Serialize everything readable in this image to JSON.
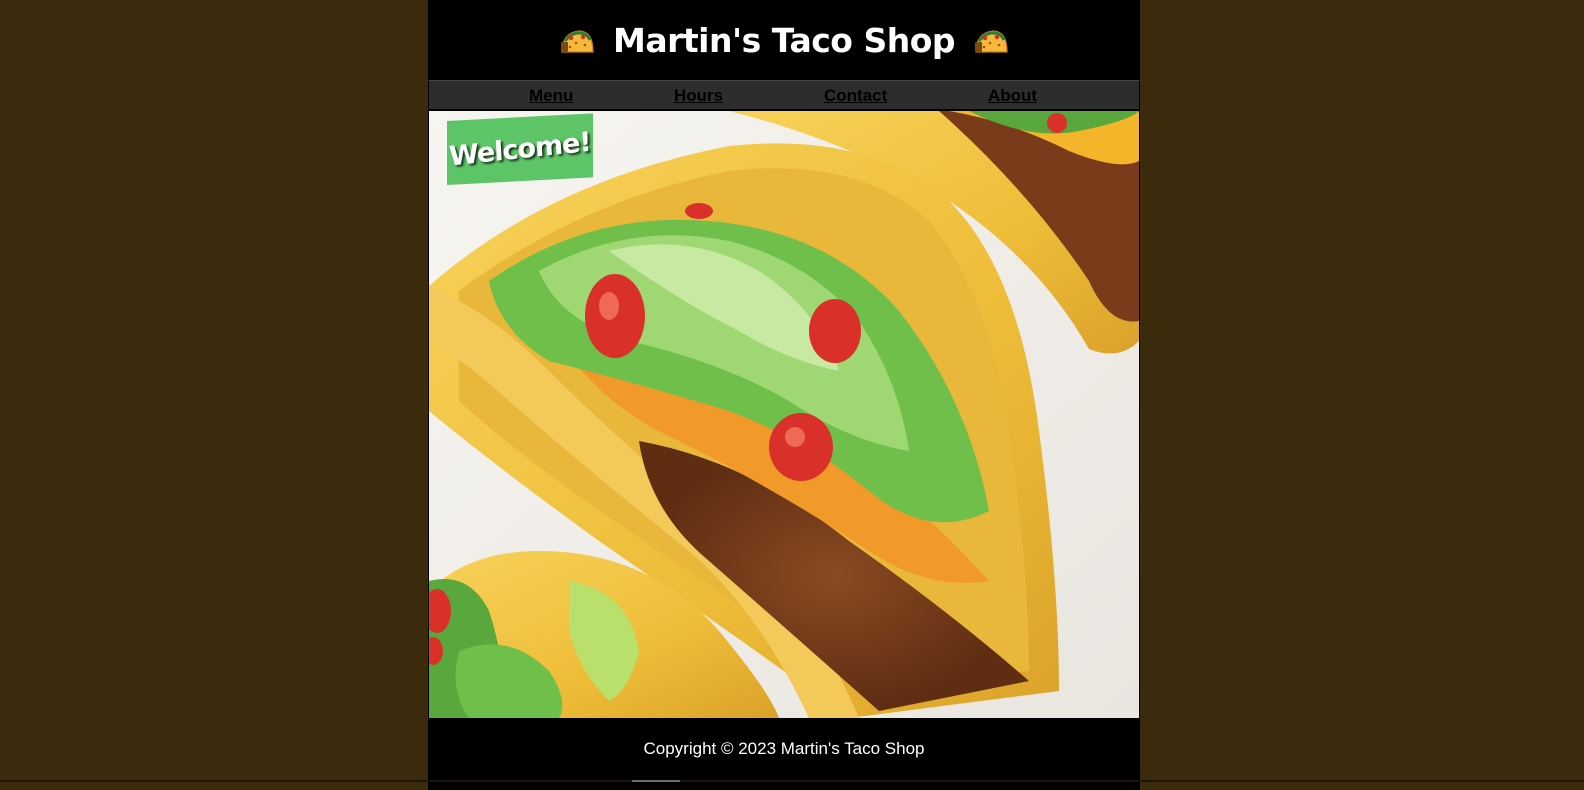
{
  "header": {
    "title": "Martin's Taco Shop",
    "left_icon": "taco-icon",
    "right_icon": "taco-icon"
  },
  "nav": {
    "items": [
      {
        "label": "Menu"
      },
      {
        "label": "Hours"
      },
      {
        "label": "Contact"
      },
      {
        "label": "About"
      }
    ]
  },
  "hero": {
    "badge_text": "Welcome!",
    "badge_color": "#5dc567",
    "image_subject": "crunchy tacos with lettuce, tomato, cheese and ground beef"
  },
  "footer": {
    "copyright": "Copyright © 2023 Martin's Taco Shop"
  },
  "colors": {
    "page_background": "#3b2a0c",
    "content_background": "#000000",
    "nav_background": "#2d2d2d"
  }
}
